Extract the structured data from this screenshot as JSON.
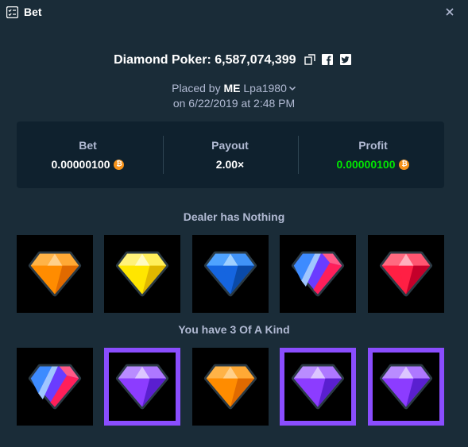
{
  "header": {
    "title": "Bet",
    "icon": "bet-slip-icon"
  },
  "game": {
    "name": "Diamond Poker:",
    "bet_id": "6,587,074,399",
    "actions": [
      "copy-icon",
      "facebook-icon",
      "twitter-icon"
    ]
  },
  "placed": {
    "prefix": "Placed by",
    "badge": "ME",
    "username": "Lpa1980",
    "datetime": "on 6/22/2019 at 2:48 PM"
  },
  "stats": {
    "bet": {
      "label": "Bet",
      "value": "0.00000100"
    },
    "payout": {
      "label": "Payout",
      "value": "2.00×"
    },
    "profit": {
      "label": "Profit",
      "value": "0.00000100"
    }
  },
  "dealer": {
    "label": "Dealer has Nothing",
    "gems": [
      "orange",
      "yellow",
      "blue",
      "red-blue-purple",
      "red"
    ]
  },
  "player": {
    "label": "You have 3 Of A Kind",
    "gems": [
      "red-blue-purple",
      "purple",
      "orange",
      "purple",
      "purple"
    ],
    "held": [
      false,
      true,
      false,
      true,
      true
    ]
  },
  "colors": {
    "background": "#1a2c38",
    "panel": "#0f212e",
    "profit": "#00e701",
    "highlight": "#8a4dfe",
    "gem_orange": "#ff8c00",
    "gem_yellow": "#ffe600",
    "gem_blue": "#1565e0",
    "gem_red": "#ff1f44",
    "gem_purple": "#8c3cff"
  }
}
